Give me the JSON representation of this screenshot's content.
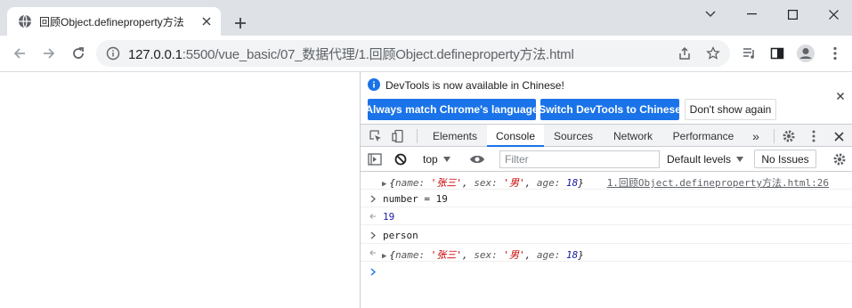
{
  "browser": {
    "tab_title": "回顾Object.defineproperty方法",
    "url_host": "127.0.0.1",
    "url_path": ":5500/vue_basic/07_数据代理/1.回顾Object.defineproperty方法.html"
  },
  "devtools": {
    "infobar": {
      "message": "DevTools is now available in Chinese!",
      "btn_match": "Always match Chrome's language",
      "btn_switch": "Switch DevTools to Chinese",
      "btn_dont_show": "Don't show again"
    },
    "tabs": [
      {
        "label": "Elements"
      },
      {
        "label": "Console"
      },
      {
        "label": "Sources"
      },
      {
        "label": "Network"
      },
      {
        "label": "Performance"
      }
    ],
    "more_tabs": "»",
    "console_bar": {
      "context": "top",
      "filter_placeholder": "Filter",
      "levels": "Default levels",
      "issues": "No Issues"
    },
    "console": {
      "log1": {
        "name_key": "name: ",
        "name_val": "'张三'",
        "sex_key": "sex: ",
        "sex_val": "'男'",
        "age_key": "age: ",
        "age_val": "18",
        "source": "1.回顾Object.defineproperty方法.html:26"
      },
      "in1": "number = 19",
      "out1": "19",
      "in2": "person",
      "out2": {
        "name_key": "name: ",
        "name_val": "'张三'",
        "sex_key": "sex: ",
        "sex_val": "'男'",
        "age_key": "age: ",
        "age_val": "18"
      }
    }
  },
  "colors": {
    "accent": "#1a73e8",
    "string": "#c80000",
    "number": "#1a1aa6"
  }
}
